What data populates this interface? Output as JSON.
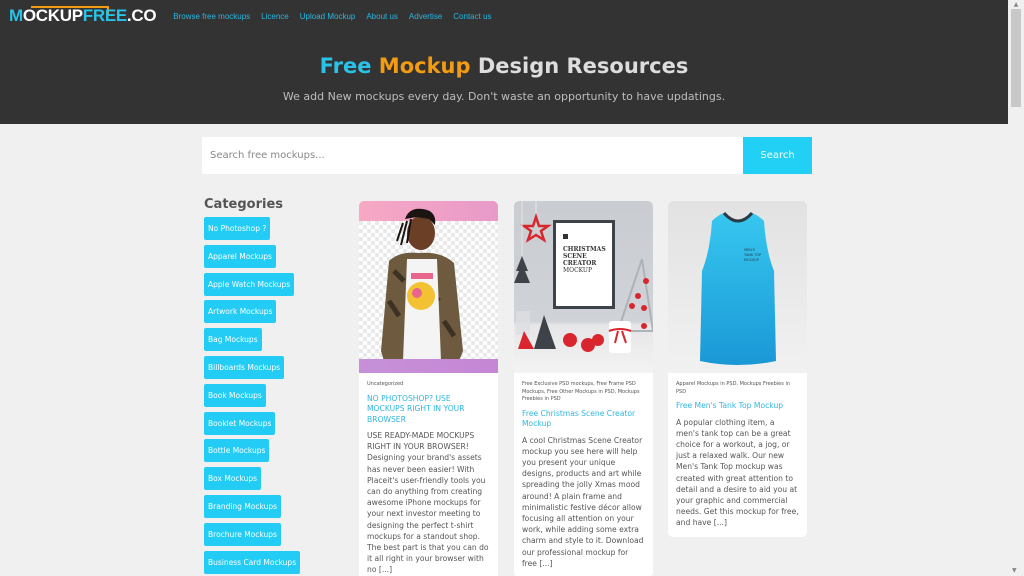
{
  "header": {
    "logo": {
      "m": "M",
      "ockup": "OCKUP",
      "free": "FREE",
      "co": ".CO"
    },
    "nav": [
      {
        "label": "Browse free mockups"
      },
      {
        "label": "Licence"
      },
      {
        "label": "Upload Mockup"
      },
      {
        "label": "About us"
      },
      {
        "label": "Advertise"
      },
      {
        "label": "Contact us"
      }
    ],
    "hero_title": {
      "part1": "Free",
      "part2": "Mockup",
      "part3": "Design Resources"
    },
    "hero_subtitle": "We add New mockups every day. Don't waste an opportunity to have updatings."
  },
  "search": {
    "placeholder": "Search free mockups...",
    "value": "",
    "button_label": "Search"
  },
  "sidebar": {
    "title": "Categories",
    "categories": [
      {
        "label": "No Photoshop ?"
      },
      {
        "label": "Apparel Mockups"
      },
      {
        "label": "Apple Watch Mockups"
      },
      {
        "label": "Artwork Mockups"
      },
      {
        "label": "Bag Mockups"
      },
      {
        "label": "Billboards Mockups"
      },
      {
        "label": "Book Mockups"
      },
      {
        "label": "Booklet Mockups"
      },
      {
        "label": "Bottle Mockups"
      },
      {
        "label": "Box Mockups"
      },
      {
        "label": "Branding Mockups"
      },
      {
        "label": "Brochure Mockups"
      },
      {
        "label": "Business Card Mockups"
      }
    ]
  },
  "posts": [
    {
      "image": "person-in-camo-jacket-tshirt-mockup",
      "meta": "Uncategorized",
      "title": "NO PHOTOSHOP? USE MOCKUPS RIGHT IN YOUR BROWSER",
      "excerpt": "USE READY-MADE MOCKUPS RIGHT IN YOUR BROWSER! Designing your brand's assets has never been easier! With Placeit's user-friendly tools you can do anything from creating awesome iPhone mockups for your next investor meeting to designing the perfect t-shirt mockups for a standout shop. The best part is that you can do it all right in your browser with no [...]"
    },
    {
      "image": "christmas-scene-frame-mockup",
      "image_text": [
        "CHRISTMAS",
        "SCENE",
        "CREATOR",
        "MOCKUP"
      ],
      "meta": "Free Exclusive PSD mockups, Free Frame PSD Mockups, Free Other Mockups in PSD, Mockups Freebies in PSD",
      "title": "Free Christmas Scene Creator Mockup",
      "excerpt": "A cool Christmas Scene Creator mockup you see here will help you present your unique designs, products and art while spreading the jolly Xmas mood around! A plain frame and minimalistic festive décor allow focusing all attention on your work, while adding some extra charm and style to it. Download our professional mockup for free [...]"
    },
    {
      "image": "blue-mens-tank-top-mockup",
      "meta": "Apparel Mockups in PSD, Mockups Freebies in PSD",
      "title": "Free Men's Tank Top Mockup",
      "excerpt": "A popular clothing item, a men's tank top can be a great choice for a workout, a jog, or just a relaxed walk. Our new Men's Tank Top mockup was created with great attention to detail and a desire to aid you at your graphic and commercial needs. Get this mockup for free, and have [...]"
    }
  ],
  "colors": {
    "accent_blue": "#22ccf5",
    "accent_orange": "#f39c12",
    "header_bg": "#333333",
    "page_bg": "#f0f0f0"
  }
}
